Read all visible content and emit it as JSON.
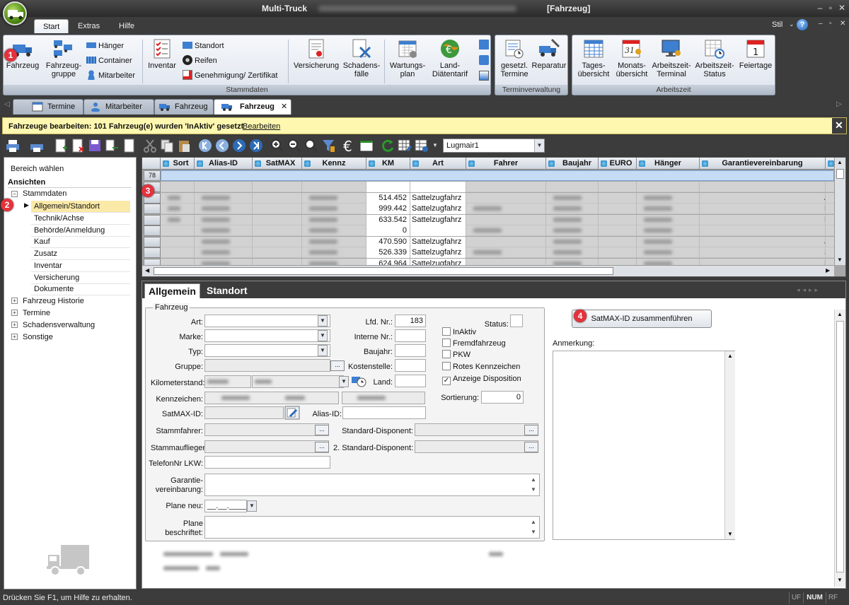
{
  "window": {
    "app_title": "Multi-Truck",
    "doc_title": "[Fahrzeug]",
    "min": "–",
    "restore": "▫",
    "close": "✕"
  },
  "ribbon_tabs": [
    {
      "label": "Start",
      "active": true
    },
    {
      "label": "Extras",
      "active": false
    },
    {
      "label": "Hilfe",
      "active": false
    }
  ],
  "ribbon_right": {
    "style_label": "Stil",
    "help_label": "?"
  },
  "ribbon": {
    "stammdaten": {
      "group_label": "Stammdaten",
      "fahrzeug": "Fahrzeug",
      "fahrzeuggruppe_1": "Fahrzeug-",
      "fahrzeuggruppe_2": "gruppe",
      "haenger": "Hänger",
      "container": "Container",
      "mitarbeiter": "Mitarbeiter",
      "inventar": "Inventar",
      "standort": "Standort",
      "reifen": "Reifen",
      "genehmigung": "Genehmigung/ Zertifikat",
      "versicherung": "Versicherung",
      "schadensfaelle_1": "Schadens-",
      "schadensfaelle_2": "fälle",
      "wartungsplan_1": "Wartungs-",
      "wartungsplan_2": "plan",
      "land_1": "Land-",
      "land_2": "Diätentarif"
    },
    "terminverwaltung": {
      "group_label": "Terminverwaltung",
      "gesetzl_1": "gesetzl.",
      "gesetzl_2": "Termine",
      "reparatur": "Reparatur"
    },
    "arbeitszeit": {
      "group_label": "Arbeitszeit",
      "tages_1": "Tages-",
      "tages_2": "übersicht",
      "monats_1": "Monats-",
      "monats_2": "übersicht",
      "terminal_1": "Arbeitszeit-",
      "terminal_2": "Terminal",
      "status_1": "Arbeitszeit-",
      "status_2": "Status",
      "feiertage": "Feiertage",
      "calendar_day": "1",
      "monats_cal": "31"
    }
  },
  "doc_tabs": [
    {
      "label": "Termine",
      "active": false
    },
    {
      "label": "Mitarbeiter",
      "active": false
    },
    {
      "label": "Fahrzeug",
      "active": false
    },
    {
      "label": "Fahrzeug",
      "active": true
    }
  ],
  "doc_tab_close": "✕",
  "notification": {
    "text": "Fahrzeuge bearbeiten: 101 Fahrzeug(e) wurden 'InAktiv' gesetzt",
    "link": "Bearbeiten",
    "close": "✕"
  },
  "toolbar": {
    "filter_value": "Lugmair1"
  },
  "left_nav": {
    "bereich": "Bereich wählen",
    "ansichten": "Ansichten",
    "stammdaten": "Stammdaten",
    "items": [
      "Allgemein/Standort",
      "Technik/Achse",
      "Behörde/Anmeldung",
      "Kauf",
      "Zusatz",
      "Inventar",
      "Versicherung",
      "Dokumente"
    ],
    "groups": [
      "Fahrzeug Historie",
      "Termine",
      "Schadensverwaltung",
      "Sonstige"
    ]
  },
  "grid": {
    "columns": [
      "Sort",
      "Alias-ID",
      "SatMAX",
      "Kennz",
      "KM",
      "Art",
      "Fahrer",
      "Baujahr",
      "EURO",
      "Hänger",
      "Garantievereinbarung"
    ],
    "filter_row_count": "78",
    "rows": [
      {
        "km": "",
        "art": "",
        "last": ""
      },
      {
        "km": "514.452",
        "art": "Sattelzugfahrz",
        "last": "A."
      },
      {
        "km": "999.442",
        "art": "Sattelzugfahrz",
        "last": "R."
      },
      {
        "km": "633.542",
        "art": "Sattelzugfahrz",
        "last": "R."
      },
      {
        "km": "0",
        "art": "",
        "last": ""
      },
      {
        "km": "470.590",
        "art": "Sattelzugfahrz",
        "last": "J."
      },
      {
        "km": "526.339",
        "art": "Sattelzugfahrz",
        "last": "S."
      },
      {
        "km": "624.964",
        "art": "Sattelzugfahrz",
        "last": "F."
      }
    ]
  },
  "detail": {
    "tabs": [
      "Allgemein",
      "Standort"
    ],
    "group_label": "Fahrzeug",
    "art": "Art:",
    "marke": "Marke:",
    "typ": "Typ:",
    "gruppe": "Gruppe:",
    "kilometerstand": "Kilometerstand:",
    "kennzeichen": "Kennzeichen:",
    "satmax_id": "SatMAX-ID:",
    "alias_id": "Alias-ID:",
    "stammfahrer": "Stammfahrer:",
    "stammauflieger": "Stammauflieger:",
    "telefon": "TelefonNr LKW:",
    "garantie_1": "Garantie-",
    "garantie_2": "vereinbarung:",
    "plane_neu": "Plane neu:",
    "plane_neu_value": "__.__.____",
    "plane_b_1": "Plane",
    "plane_b_2": "beschriftet:",
    "lfd_nr": "Lfd. Nr.:",
    "lfd_nr_value": "183",
    "interne_nr": "Interne Nr.:",
    "baujahr": "Baujahr:",
    "kostenstelle": "Kostenstelle:",
    "land": "Land:",
    "standard_disponent": "Standard-Disponent:",
    "standard_disponent_2": "2. Standard-Disponent:",
    "status": "Status:",
    "checkboxes": [
      {
        "label": "InAktiv",
        "checked": false
      },
      {
        "label": "Fremdfahrzeug",
        "checked": false
      },
      {
        "label": "PKW",
        "checked": false
      },
      {
        "label": "Rotes Kennzeichen",
        "checked": false
      },
      {
        "label": "Anzeige Disposition",
        "checked": true
      }
    ],
    "sortierung": "Sortierung:",
    "sortierung_value": "0",
    "merge_button": "SatMAX-ID zusammenführen",
    "anmerkung": "Anmerkung:"
  },
  "statusbar": {
    "text": "Drücken Sie F1, um Hilfe zu erhalten.",
    "uf": "UF",
    "num": "NUM",
    "rf": "RF"
  },
  "badges": [
    "1",
    "2",
    "3",
    "4"
  ],
  "colors": {
    "accent": "#3a6fc4",
    "badge": "#e4323c",
    "notification": "#fdf7b0",
    "selection": "#fbe9a8"
  }
}
